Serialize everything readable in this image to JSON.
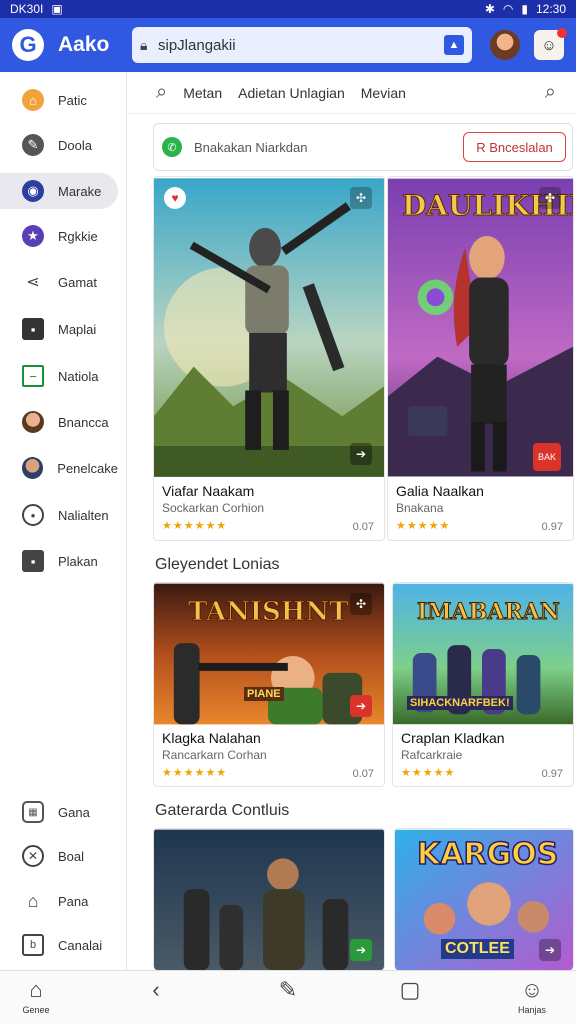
{
  "status": {
    "time_left": "DK30I",
    "time_right": "12:30"
  },
  "appbar": {
    "title": "Aako",
    "search_value": "sipJlangakii"
  },
  "sidebar": {
    "items": [
      {
        "label": "Patic",
        "icon": "home-icon",
        "color": "#f2a23a"
      },
      {
        "label": "Doola",
        "icon": "edit-icon",
        "color": "#555555"
      },
      {
        "label": "Marake",
        "icon": "globe-icon",
        "color": "#2c3e9e"
      },
      {
        "label": "Rgkkie",
        "icon": "star-icon",
        "color": "#5a3fb3"
      },
      {
        "label": "Gamat",
        "icon": "share-icon",
        "color": "#444444"
      },
      {
        "label": "Maplai",
        "icon": "bag-icon",
        "color": "#333333"
      },
      {
        "label": "Natiola",
        "icon": "tablet-icon",
        "color": "#1d8f3a"
      },
      {
        "label": "Bnancca",
        "icon": "avatar-icon",
        "color": "#7a4a2a"
      },
      {
        "label": "Penelcake",
        "icon": "avatar-icon",
        "color": "#3a5a8a"
      },
      {
        "label": "Nalialten",
        "icon": "chat-icon",
        "color": "#444444"
      },
      {
        "label": "Plakan",
        "icon": "folder-icon",
        "color": "#444444"
      }
    ],
    "bottom_items": [
      {
        "label": "Gana",
        "icon": "calendar-icon"
      },
      {
        "label": "Boal",
        "icon": "tools-icon"
      },
      {
        "label": "Pana",
        "icon": "house-icon"
      },
      {
        "label": "Canalai",
        "icon": "book-icon"
      }
    ]
  },
  "filterbar": {
    "items": [
      "Metan",
      "Adietan Unlagian",
      "Mevian"
    ]
  },
  "promo": {
    "text": "Bnakakan Niarkdan",
    "button": "R Bnceslalan"
  },
  "featured": [
    {
      "title": "Viafar Naakam",
      "subtitle": "Sockarkan Corhion",
      "stars": "★★★★★★",
      "count": "0.07",
      "banner": ""
    },
    {
      "title": "Galia Naalkan",
      "subtitle": "Bnakana",
      "stars": "★★★★★",
      "count": "0.97",
      "banner": "DAULIKHILA"
    }
  ],
  "section1": {
    "title": "Gleyendet Lonias",
    "cards": [
      {
        "title": "Klagka Nalahan",
        "subtitle": "Rancarkarn Corhan",
        "stars": "★★★★★★",
        "count": "0.07",
        "banner": "TANISHNT",
        "badge": "PIANE"
      },
      {
        "title": "Craplan Kladkan",
        "subtitle": "Rafcarkraie",
        "stars": "★★★★★",
        "count": "0.97",
        "banner": "IMABARAN",
        "badge": "SIHACKNARFBEK!"
      }
    ]
  },
  "section2": {
    "title": "Gaterarda Contluis",
    "cards": [
      {
        "banner": ""
      },
      {
        "banner": "KARGOS",
        "badge": "COTLEE"
      }
    ]
  },
  "bottomnav": {
    "items": [
      {
        "label": "Genee",
        "icon": "home-icon"
      },
      {
        "label": "",
        "icon": "back-icon"
      },
      {
        "label": "",
        "icon": "pen-icon"
      },
      {
        "label": "",
        "icon": "square-icon"
      },
      {
        "label": "Hanjas",
        "icon": "person-icon"
      }
    ]
  }
}
